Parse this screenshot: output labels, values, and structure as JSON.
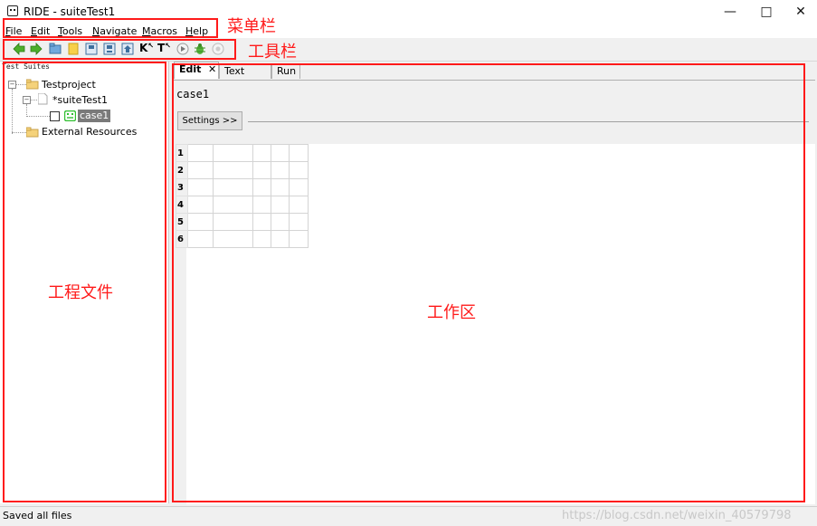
{
  "window": {
    "title": "RIDE - suiteTest1",
    "minimize_glyph": "—",
    "maximize_glyph": "□",
    "close_glyph": "✕"
  },
  "menu": [
    {
      "underline": "F",
      "rest": "ile"
    },
    {
      "underline": "E",
      "rest": "dit"
    },
    {
      "underline": "T",
      "rest": "ools"
    },
    {
      "underline": "N",
      "rest": "avigate"
    },
    {
      "underline": "M",
      "rest": "acros"
    },
    {
      "underline": "H",
      "rest": "elp"
    }
  ],
  "toolbar": {
    "icons": [
      "back-arrow-icon",
      "forward-arrow-icon",
      "open-folder-icon",
      "new-file-icon",
      "save-icon",
      "save-all-icon",
      "import-icon",
      "keyword-search-icon",
      "test-search-icon",
      "run-icon",
      "debug-icon",
      "stop-icon"
    ],
    "k_label": "K",
    "t_label": "T"
  },
  "left_panel": {
    "header": "Test Suites",
    "tree": {
      "project": "Testproject",
      "suite": "*suiteTest1",
      "case": "case1",
      "external": "External Resources"
    }
  },
  "tabs": {
    "edit": "Edit",
    "edit_close": "✕",
    "text_edit": "Text Edit",
    "run": "Run"
  },
  "editor": {
    "case_name": "case1",
    "settings_label": "Settings >>",
    "row_numbers": [
      "1",
      "2",
      "3",
      "4",
      "5",
      "6"
    ]
  },
  "status": {
    "text": "Saved all files",
    "watermark": "https://blog.csdn.net/weixin_40579798"
  },
  "annotations": {
    "menubar": "菜单栏",
    "toolbar": "工具栏",
    "project_files": "工程文件",
    "workspace": "工作区"
  },
  "colors": {
    "annotation_red": "#ff1a1a",
    "case_icon_green": "#2fbf2f",
    "selected_bg": "#7a7a7a"
  }
}
